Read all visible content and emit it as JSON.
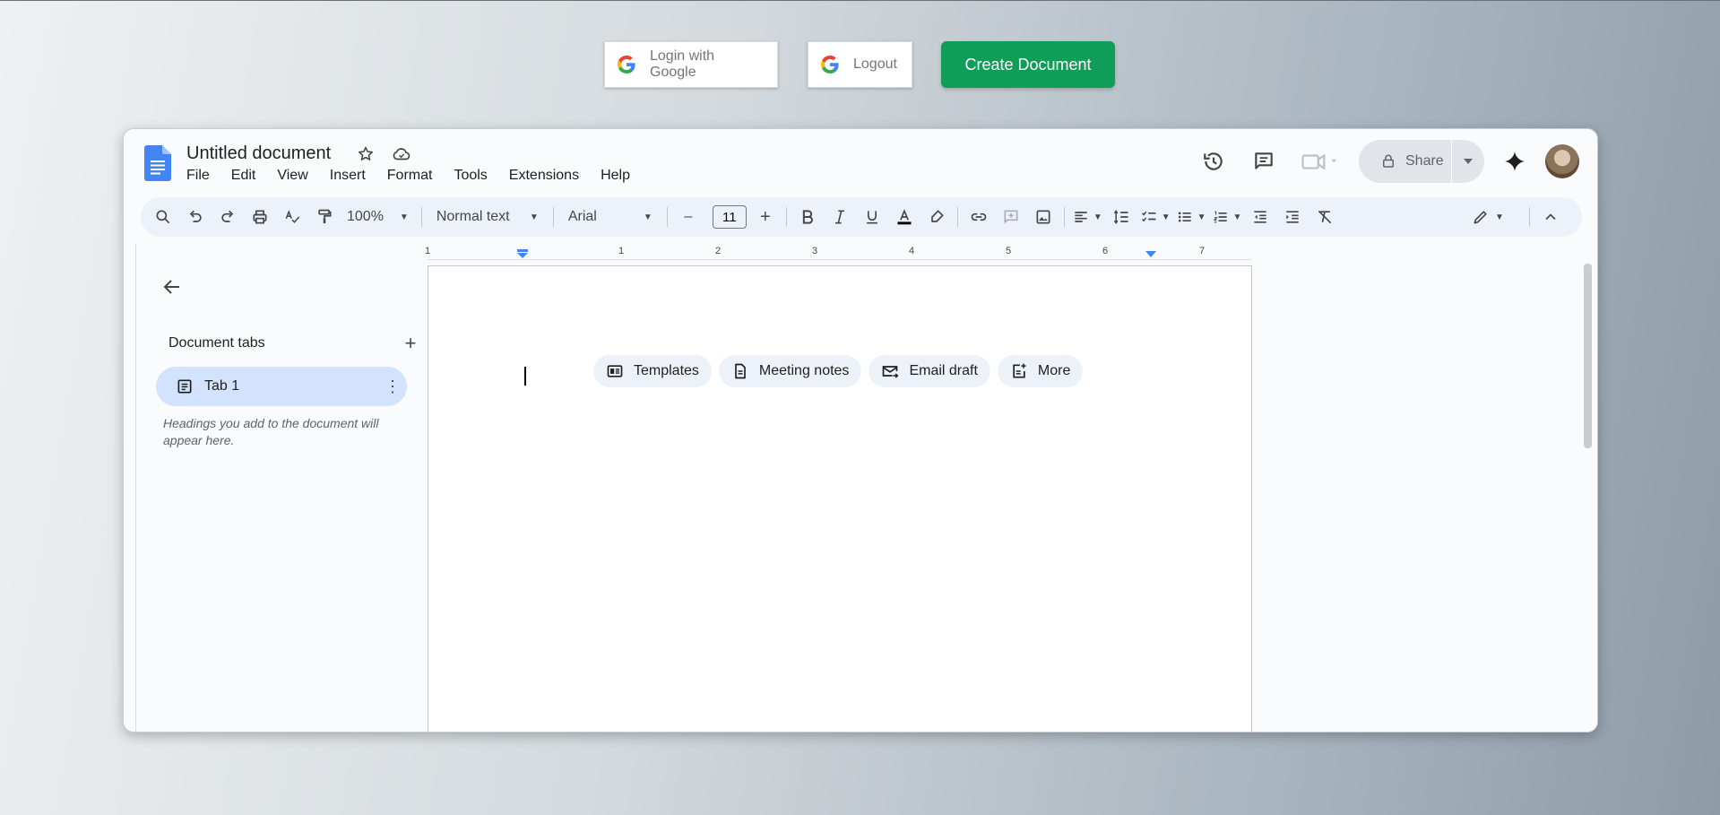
{
  "top_buttons": {
    "login_label": "Login with Google",
    "logout_label": "Logout",
    "create_label": "Create Document",
    "create_color": "#0f9d58"
  },
  "docs": {
    "title": "Untitled document",
    "menu": [
      "File",
      "Edit",
      "View",
      "Insert",
      "Format",
      "Tools",
      "Extensions",
      "Help"
    ],
    "share_label": "Share",
    "toolbar": {
      "zoom": "100%",
      "style": "Normal text",
      "font": "Arial",
      "font_size": "11",
      "minus": "–",
      "plus": "+"
    },
    "sidebar": {
      "heading": "Document tabs",
      "add": "+",
      "tab_label": "Tab 1",
      "hint": "Headings you add to the document will appear here."
    },
    "ruler": [
      "1",
      "1",
      "2",
      "3",
      "4",
      "5",
      "6",
      "7"
    ],
    "chips": [
      {
        "label": "Templates",
        "icon": "templates-icon"
      },
      {
        "label": "Meeting notes",
        "icon": "document-icon"
      },
      {
        "label": "Email draft",
        "icon": "email-icon"
      },
      {
        "label": "More",
        "icon": "more-doc-icon"
      }
    ],
    "accent_color": "#d3e3fd"
  }
}
